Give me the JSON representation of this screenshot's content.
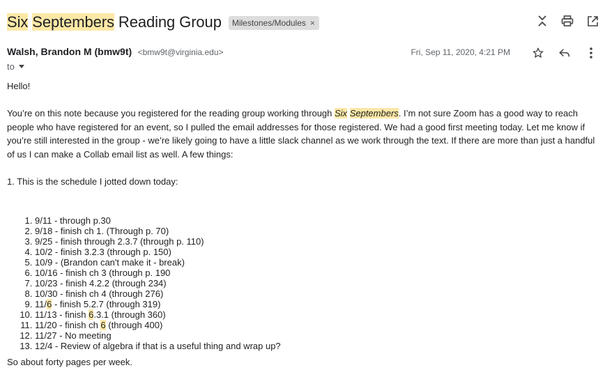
{
  "subject": {
    "w1": "Six",
    "w2": "Septembers",
    "rest": "Reading Group",
    "label_chip": "Milestones/Modules",
    "chip_close": "×"
  },
  "toolbar": {
    "collapse_icon": "collapse-all-icon",
    "print_icon": "print-icon",
    "popout_icon": "open-in-new-window-icon"
  },
  "message": {
    "sender_name": "Walsh, Brandon M (bmw9t)",
    "sender_email": "<bmw9t@virginia.edu>",
    "date": "Fri, Sep 11, 2020, 4:21 PM",
    "to_label": "to",
    "greeting": "Hello!",
    "p1_a": "You’re on this note because you registered for the reading group working through ",
    "p1_six": "Six",
    "p1_sept": "Septembers",
    "p1_b": ". I’m not sure Zoom has a good way to reach people who have registered for an event, so I pulled the email addresses for those registered. We had a good first meeting today. Let me know if you’re still interested in the group - we’re likely going to have a little slack channel as we work through the text. If there are more than just a handful of us I can make a Collab email list as well. A few things:",
    "p2": "1. This is the schedule I jotted down today:",
    "schedule": {
      "i1": "9/11 - through p.30",
      "i2": "9/18 - finish ch 1. (Through p. 70)",
      "i3": "9/25 - finish through 2.3.7 (through p. 110)",
      "i4": "10/2 - finish 3.2.3 (through p. 150)",
      "i5": "10/9 - (Brandon can't make it - break)",
      "i6": "10/16 - finish ch 3 (through p. 190",
      "i7": "10/23 - finish 4.2.2 (through 234)",
      "i8": "10/30 - finish ch 4 (through 276)",
      "i9_a": "11/",
      "i9_h": "6",
      "i9_b": " - finish 5.2.7 (through 319)",
      "i10_a": "11/13 - finish ",
      "i10_h": "6",
      "i10_b": ".3.1 (through 360)",
      "i11_a": "11/20 - finish ch ",
      "i11_h": "6",
      "i11_b": " (through 400)",
      "i12": "11/27 - No meeting",
      "i13": "12/4 - Review of algebra if that is a useful thing and wrap up?"
    },
    "closing": "So about forty pages per week."
  },
  "colors": {
    "highlight": "#fce8a6",
    "chip_bg": "#dddddd",
    "text": "#222222",
    "muted": "#5f6368"
  }
}
